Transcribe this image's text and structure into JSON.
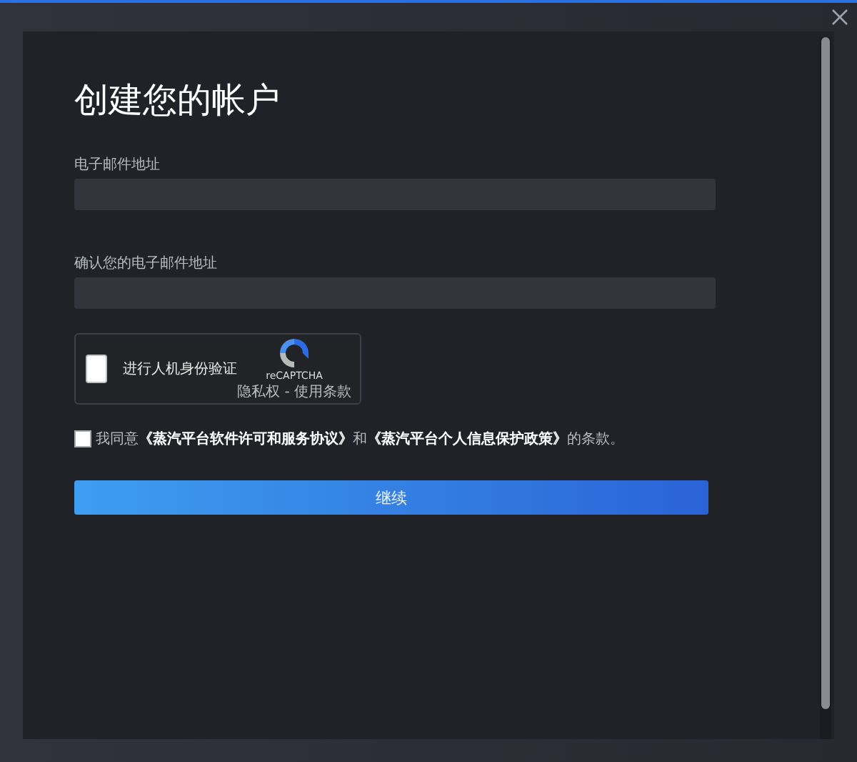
{
  "title": "创建您的帐户",
  "fields": [
    {
      "label": "电子邮件地址"
    },
    {
      "label": "确认您的电子邮件地址"
    }
  ],
  "captcha": {
    "label": "进行人机身份验证",
    "checked": false,
    "brand": "reCAPTCHA",
    "links": "隐私权 - 使用条款"
  },
  "agreement": {
    "checked": false,
    "parts": [
      {
        "kind": "text",
        "text": "我同意"
      },
      {
        "kind": "link",
        "text": "《蒸汽平台软件许可和服务协议》"
      },
      {
        "kind": "text",
        "text": "和"
      },
      {
        "kind": "link",
        "text": "《蒸汽平台个人信息保护政策》"
      },
      {
        "kind": "text",
        "text": "的条款。"
      }
    ]
  },
  "continue_button": "继续"
}
